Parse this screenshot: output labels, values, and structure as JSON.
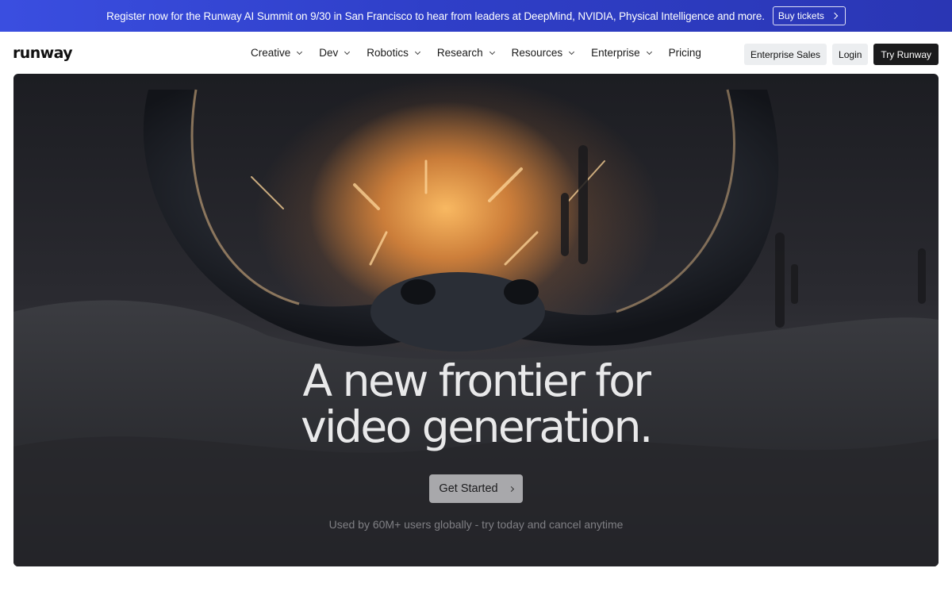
{
  "announcement": {
    "text": "Register now for the Runway AI Summit on 9/30 in San Francisco to hear from leaders at DeepMind, NVIDIA, Physical Intelligence and more.",
    "button_label": "Buy tickets",
    "button_icon": "chevron-right-icon"
  },
  "nav": {
    "logo": "runway",
    "items": [
      {
        "label": "Creative",
        "has_dropdown": true
      },
      {
        "label": "Dev",
        "has_dropdown": true
      },
      {
        "label": "Robotics",
        "has_dropdown": true
      },
      {
        "label": "Research",
        "has_dropdown": true
      },
      {
        "label": "Resources",
        "has_dropdown": true
      },
      {
        "label": "Enterprise",
        "has_dropdown": true
      },
      {
        "label": "Pricing",
        "has_dropdown": false
      }
    ],
    "actions": {
      "enterprise_sales": "Enterprise Sales",
      "login": "Login",
      "try": "Try Runway"
    }
  },
  "hero": {
    "title_line1": "A new frontier for",
    "title_line2": "video generation.",
    "cta_label": "Get Started",
    "subtitle": "Used by 60M+ users globally - try today and cancel anytime"
  },
  "colors": {
    "announcement_bg": "#2f3fc8",
    "primary_dark": "#1b1b1c",
    "ghost_button": "#eceef0"
  }
}
